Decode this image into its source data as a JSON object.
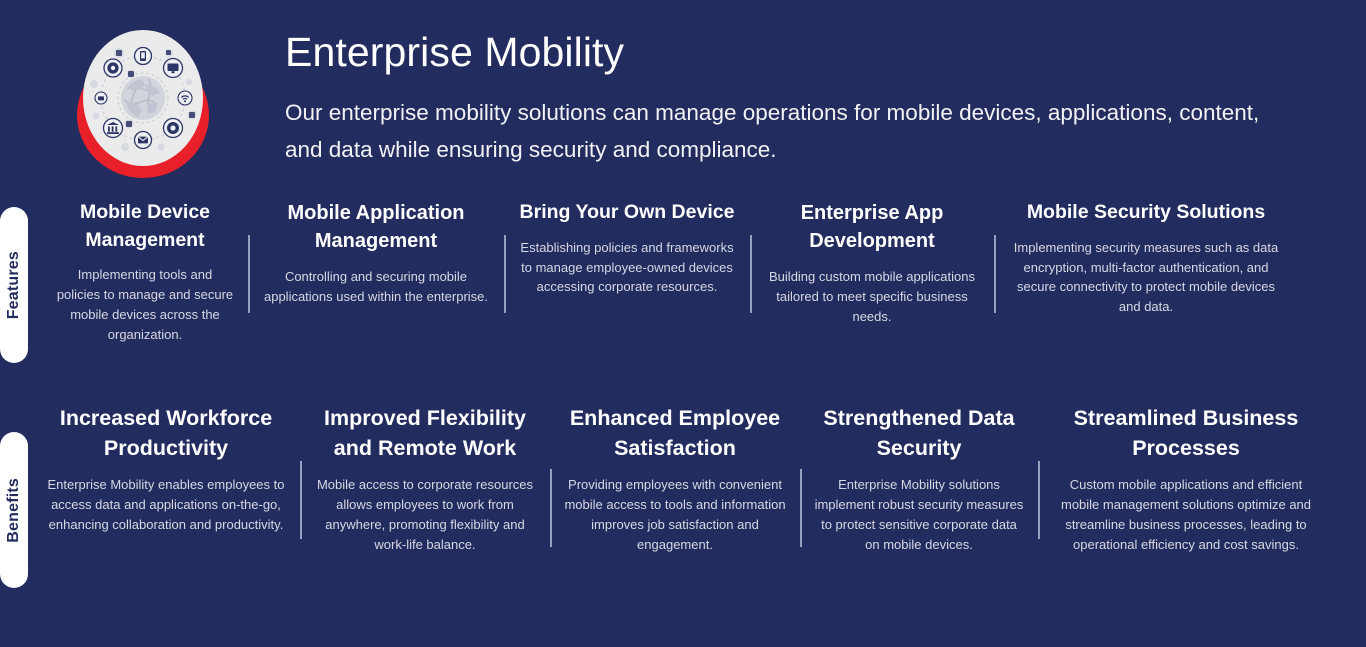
{
  "header": {
    "title": "Enterprise Mobility",
    "subtitle": "Our enterprise mobility solutions can manage operations for mobile devices, applications, content, and data while ensuring security and compliance.",
    "logo_icon": "globe-network-devices-icon"
  },
  "colors": {
    "background": "#232c5e",
    "accent_red": "#e8202a",
    "logo_disc": "#ebebeb",
    "divider": "#9aa0c0",
    "title_text": "#ffffff",
    "body_text": "#d6d8e4",
    "pill_background": "#ffffff",
    "pill_text": "#232c5e"
  },
  "sections": [
    {
      "label": "Features",
      "cards": [
        {
          "title": "Mobile Device Management",
          "desc": "Implementing tools and policies to manage and secure mobile devices across the organization."
        },
        {
          "title": "Mobile Application Management",
          "desc": "Controlling and securing mobile applications used within the enterprise."
        },
        {
          "title": "Bring Your Own Device",
          "desc": "Establishing policies and frameworks to manage employee-owned devices accessing corporate resources."
        },
        {
          "title": "Enterprise App Development",
          "desc": "Building custom mobile applications tailored to meet specific business needs."
        },
        {
          "title": "Mobile Security Solutions",
          "desc": "Implementing security measures such as data encryption, multi-factor authentication, and secure connectivity to protect mobile devices and data."
        }
      ]
    },
    {
      "label": "Benefits",
      "cards": [
        {
          "title": "Increased Workforce Productivity",
          "desc": "Enterprise Mobility enables employees to access data and applications on-the-go, enhancing collaboration and productivity."
        },
        {
          "title": "Improved Flexibility and Remote Work",
          "desc": "Mobile access to corporate resources allows employees to work from anywhere, promoting flexibility and work-life balance."
        },
        {
          "title": "Enhanced Employee Satisfaction",
          "desc": "Providing employees with convenient mobile access to tools and information improves job satisfaction and engagement."
        },
        {
          "title": "Strengthened Data Security",
          "desc": "Enterprise Mobility solutions implement robust security measures to protect sensitive corporate data on mobile devices."
        },
        {
          "title": "Streamlined Business Processes",
          "desc": "Custom mobile applications and efficient mobile management solutions optimize and streamline business processes, leading to operational efficiency and cost savings."
        }
      ]
    }
  ]
}
